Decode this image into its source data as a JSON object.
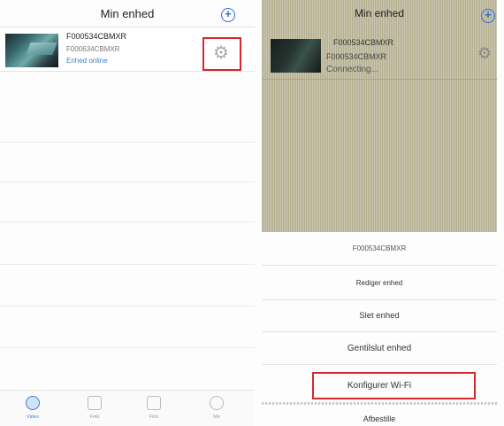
{
  "left": {
    "title": "Min enhed",
    "add_icon": "plus-circle-icon",
    "device": {
      "name": "F000534CBMXR",
      "sub_name": "F000634CBMXR",
      "status": "Enhed online"
    },
    "settings_icon": "gear-icon",
    "tabs": [
      {
        "label": "Video",
        "icon": "camera-icon"
      },
      {
        "label": "Foto",
        "icon": "photo-icon"
      },
      {
        "label": "Film",
        "icon": "film-icon"
      },
      {
        "label": "Me",
        "icon": "info-icon"
      }
    ]
  },
  "right": {
    "title": "Min enhed",
    "add_icon": "plus-circle-icon",
    "device": {
      "name": "F000534CBMXR",
      "sub_name": "F000534CBMXR",
      "status": "Connecting..."
    },
    "settings_icon": "gear-icon",
    "sheet": {
      "title": "F000534CBMXR",
      "items": [
        "Rediger enhed",
        "Slet enhed",
        "Gentilslut enhed",
        "Konfigurer Wi-Fi",
        "Afbestille"
      ]
    }
  },
  "colors": {
    "accent": "#2d6fd6",
    "highlight": "#d7262e",
    "online": "#3f82c8"
  }
}
